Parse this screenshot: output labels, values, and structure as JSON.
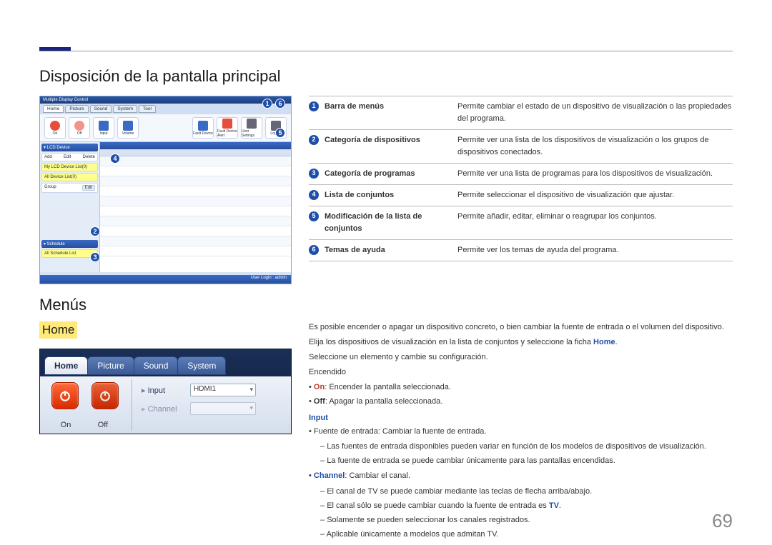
{
  "page_number": "69",
  "h1": "Disposición de la pantalla principal",
  "h2": "Menús",
  "section_home_label": "Home",
  "mdc": {
    "title": "Multiple Display Control",
    "tabs": [
      "Home",
      "Picture",
      "Sound",
      "System",
      "Tool"
    ],
    "tools": [
      "On",
      "Off",
      "Input",
      "Volume",
      "Fault Device",
      "Fault Device Alert",
      "User Settings",
      "Logout"
    ],
    "side_header1": "▾ LCD Device",
    "side_row_actions": [
      "Add",
      "Edit",
      "Delete"
    ],
    "side_yellow1": "My LCD Device List(0)",
    "side_yellow2": "All Device List(0)",
    "side_group": "Group",
    "side_group_edit": "Edit",
    "side_header2": "▾ Schedule",
    "side_sched": "All Schedule List",
    "status": "User Login : admin"
  },
  "callouts": {
    "c1": "1",
    "c2": "2",
    "c3": "3",
    "c4": "4",
    "c5": "5",
    "c6": "6"
  },
  "items": [
    {
      "n": "1",
      "label": "Barra de menús",
      "desc": "Permite cambiar el estado de un dispositivo de visualización o las propiedades del programa."
    },
    {
      "n": "2",
      "label": "Categoría de dispositivos",
      "desc": "Permite ver una lista de los dispositivos de visualización o los grupos de dispositivos conectados."
    },
    {
      "n": "3",
      "label": "Categoría de programas",
      "desc": "Permite ver una lista de programas para los dispositivos de visualización."
    },
    {
      "n": "4",
      "label": "Lista de conjuntos",
      "desc": "Permite seleccionar el dispositivo de visualización que ajustar."
    },
    {
      "n": "5",
      "label": "Modificación de la lista de conjuntos",
      "desc": "Permite añadir, editar, eliminar o reagrupar los conjuntos."
    },
    {
      "n": "6",
      "label": "Temas de ayuda",
      "desc": "Permite ver los temas de ayuda del programa."
    }
  ],
  "home_shot": {
    "tabs": [
      "Home",
      "Picture",
      "Sound",
      "System"
    ],
    "btn_on": "On",
    "btn_off": "Off",
    "input_label": "Input",
    "input_value": "HDMI1",
    "channel_label": "Channel"
  },
  "text": {
    "p1": "Es posible encender o apagar un dispositivo concreto, o bien cambiar la fuente de entrada o el volumen del dispositivo.",
    "p2a": "Elija los dispositivos de visualización en la lista de conjuntos y seleccione la ficha ",
    "p2b": "Home",
    "p2c": ".",
    "p3": "Seleccione un elemento y cambie su configuración.",
    "p4": "Encendido",
    "on_label": "On",
    "on_text": ": Encender la pantalla seleccionada.",
    "off_label": "Off",
    "off_text": ": Apagar la pantalla seleccionada.",
    "input_heading": "Input",
    "src_text": "Fuente de entrada: Cambiar la fuente de entrada.",
    "src_d1": "Las fuentes de entrada disponibles pueden variar en función de los modelos de dispositivos de visualización.",
    "src_d2": "La fuente de entrada se puede cambiar únicamente para las pantallas encendidas.",
    "channel_label": "Channel",
    "channel_text": ": Cambiar el canal.",
    "ch_d1": "El canal de TV se puede cambiar mediante las teclas de flecha arriba/abajo.",
    "ch_d2a": "El canal sólo se puede cambiar cuando la fuente de entrada es ",
    "ch_d2b": "TV",
    "ch_d2c": ".",
    "ch_d3": "Solamente se pueden seleccionar los canales registrados.",
    "ch_d4": "Aplicable únicamente a modelos que admitan TV."
  }
}
